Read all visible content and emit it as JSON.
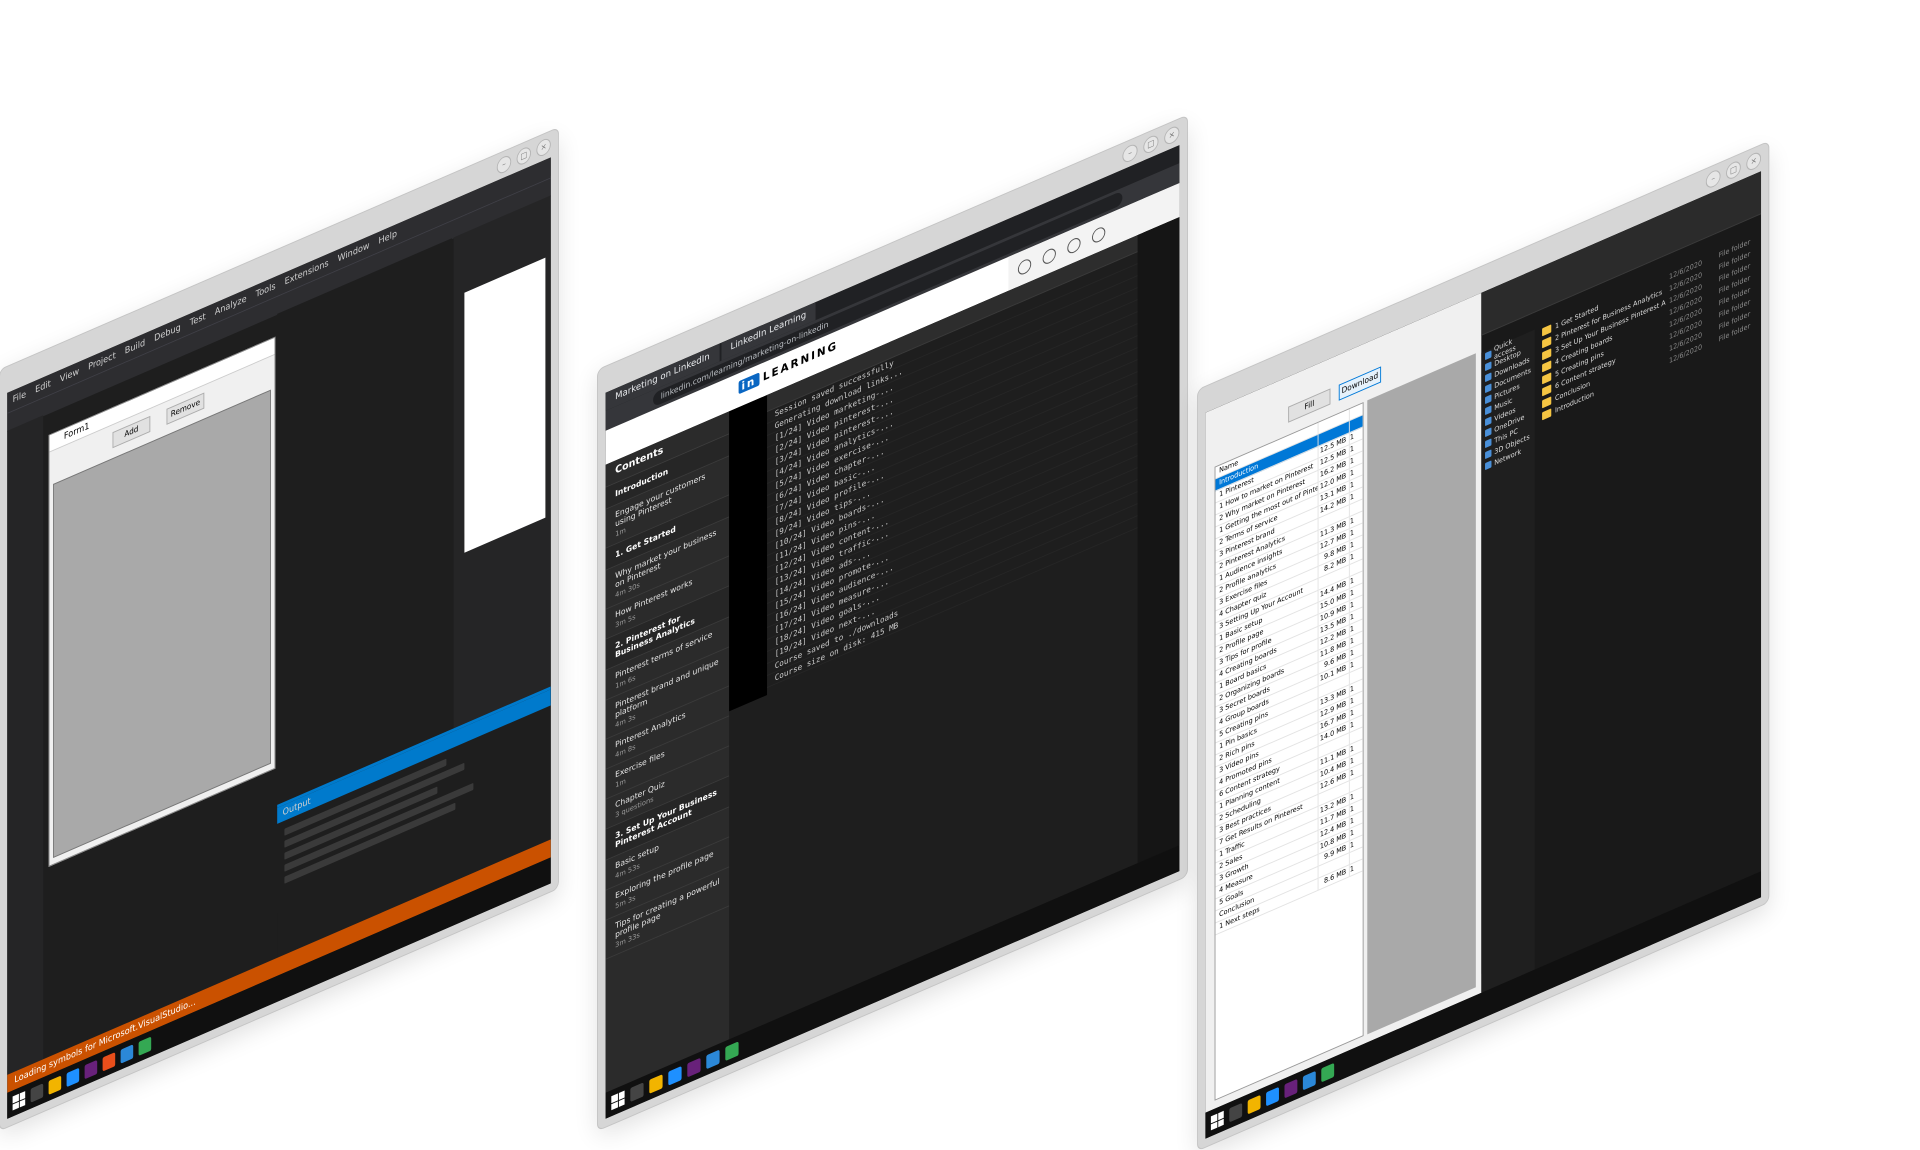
{
  "screens": {
    "vs": {
      "menu": [
        "File",
        "Edit",
        "View",
        "Project",
        "Build",
        "Debug",
        "Test",
        "Analyze",
        "Tools",
        "Extensions",
        "Window",
        "Help"
      ],
      "form_title": "Form1",
      "form_buttons": [
        "Add",
        "Remove"
      ],
      "output_tab": "Output",
      "status_text": "Loading symbols for Microsoft.VisualStudio..."
    },
    "browser": {
      "tabs": [
        "Marketing on LinkedIn",
        "LinkedIn Learning"
      ],
      "url": "linkedin.com/learning/marketing-on-linkedin",
      "logo_in": "in",
      "logo_text": "LEARNING",
      "sidebar_title": "Contents",
      "course_items": [
        {
          "type": "section",
          "title": "Introduction"
        },
        {
          "type": "item",
          "title": "Engage your customers using Pinterest",
          "dur": "1m"
        },
        {
          "type": "section",
          "title": "1. Get Started"
        },
        {
          "type": "item",
          "title": "Why market your business on Pinterest",
          "dur": "4m 30s"
        },
        {
          "type": "item",
          "title": "How Pinterest works",
          "dur": "3m 5s"
        },
        {
          "type": "section",
          "title": "2. Pinterest for Business Analytics"
        },
        {
          "type": "item",
          "title": "Pinterest terms of service",
          "dur": "1m 6s"
        },
        {
          "type": "item",
          "title": "Pinterest brand and unique platform",
          "dur": "4m 3s"
        },
        {
          "type": "item",
          "title": "Pinterest Analytics",
          "dur": "4m 8s"
        },
        {
          "type": "item",
          "title": "Exercise files",
          "dur": "1m"
        },
        {
          "type": "item",
          "title": "Chapter Quiz",
          "dur": "3 questions"
        },
        {
          "type": "section",
          "title": "3. Set Up Your Business Pinterest Account"
        },
        {
          "type": "item",
          "title": "Basic setup",
          "dur": "4m 53s"
        },
        {
          "type": "item",
          "title": "Exploring the profile page",
          "dur": "5m 3s"
        },
        {
          "type": "item",
          "title": "Tips for creating a powerful profile page",
          "dur": "3m 33s"
        }
      ],
      "terminal_lines": [
        "Session saved successfully",
        "Generating download links...",
        "[1/24] Video marketing-...",
        "[2/24] Video pinterest-...",
        "[3/24] Video pinterest-...",
        "[4/24] Video analytics-...",
        "[5/24] Video exercise-...",
        "[6/24] Video chapter-...",
        "[7/24] Video basic-...",
        "[8/24] Video profile-...",
        "[9/24] Video tips-...",
        "[10/24] Video boards-...",
        "[11/24] Video pins-...",
        "[12/24] Video content-...",
        "[13/24] Video traffic-...",
        "[14/24] Video ads-...",
        "[15/24] Video promote-...",
        "[16/24] Video audience-...",
        "[17/24] Video measure-...",
        "[18/24] Video goals-...",
        "[19/24] Video next-...",
        "Course saved to ./downloads",
        "Course size on disk: 415 MB"
      ]
    },
    "explorer": {
      "buttons": [
        "Fill",
        "Download"
      ],
      "table_rows": [
        {
          "name": "Name",
          "size": "",
          "n": ""
        },
        {
          "name": "Introduction",
          "size": "",
          "n": ""
        },
        {
          "name": "1 Pinterest",
          "size": "12.5 MB",
          "n": "1"
        },
        {
          "name": "1 How to market on Pinterest",
          "size": "12.5 MB",
          "n": "1"
        },
        {
          "name": "2 Why market on Pinterest",
          "size": "16.2 MB",
          "n": "1"
        },
        {
          "name": "1 Getting the most out of Pinterest",
          "size": "12.0 MB",
          "n": "1"
        },
        {
          "name": "2 Terms of service",
          "size": "13.1 MB",
          "n": "1"
        },
        {
          "name": "3 Pinterest brand",
          "size": "14.2 MB",
          "n": "1"
        },
        {
          "name": "2 Pinterest Analytics",
          "size": "",
          "n": ""
        },
        {
          "name": "1 Audience insights",
          "size": "11.3 MB",
          "n": "1"
        },
        {
          "name": "2 Profile analytics",
          "size": "12.7 MB",
          "n": "1"
        },
        {
          "name": "3 Exercise files",
          "size": "9.8 MB",
          "n": "1"
        },
        {
          "name": "4 Chapter quiz",
          "size": "8.2 MB",
          "n": "1"
        },
        {
          "name": "3 Setting Up Your Account",
          "size": "",
          "n": ""
        },
        {
          "name": "1 Basic setup",
          "size": "14.4 MB",
          "n": "1"
        },
        {
          "name": "2 Profile page",
          "size": "15.0 MB",
          "n": "1"
        },
        {
          "name": "3 Tips for profile",
          "size": "10.9 MB",
          "n": "1"
        },
        {
          "name": "4 Creating boards",
          "size": "13.5 MB",
          "n": "1"
        },
        {
          "name": "1 Board basics",
          "size": "12.2 MB",
          "n": "1"
        },
        {
          "name": "2 Organizing boards",
          "size": "11.8 MB",
          "n": "1"
        },
        {
          "name": "3 Secret boards",
          "size": "9.6 MB",
          "n": "1"
        },
        {
          "name": "4 Group boards",
          "size": "10.1 MB",
          "n": "1"
        },
        {
          "name": "5 Creating pins",
          "size": "",
          "n": ""
        },
        {
          "name": "1 Pin basics",
          "size": "13.3 MB",
          "n": "1"
        },
        {
          "name": "2 Rich pins",
          "size": "12.9 MB",
          "n": "1"
        },
        {
          "name": "3 Video pins",
          "size": "16.7 MB",
          "n": "1"
        },
        {
          "name": "4 Promoted pins",
          "size": "14.0 MB",
          "n": "1"
        },
        {
          "name": "6 Content strategy",
          "size": "",
          "n": ""
        },
        {
          "name": "1 Planning content",
          "size": "11.1 MB",
          "n": "1"
        },
        {
          "name": "2 Scheduling",
          "size": "10.4 MB",
          "n": "1"
        },
        {
          "name": "3 Best practices",
          "size": "12.6 MB",
          "n": "1"
        },
        {
          "name": "7 Get Results on Pinterest",
          "size": "",
          "n": ""
        },
        {
          "name": "1 Traffic",
          "size": "13.2 MB",
          "n": "1"
        },
        {
          "name": "2 Sales",
          "size": "11.7 MB",
          "n": "1"
        },
        {
          "name": "3 Growth",
          "size": "12.4 MB",
          "n": "1"
        },
        {
          "name": "4 Measure",
          "size": "10.8 MB",
          "n": "1"
        },
        {
          "name": "5 Goals",
          "size": "9.9 MB",
          "n": "1"
        },
        {
          "name": "Conclusion",
          "size": "",
          "n": ""
        },
        {
          "name": "1 Next steps",
          "size": "8.6 MB",
          "n": "1"
        }
      ],
      "nav_items": [
        "Quick access",
        "Desktop",
        "Downloads",
        "Documents",
        "Pictures",
        "Music",
        "Videos",
        "OneDrive",
        "This PC",
        "3D Objects",
        "Network"
      ],
      "folders": [
        "1 Get Started",
        "2 Pinterest for Business Analytics",
        "3 Set Up Your Business Pinterest Account",
        "4 Creating boards",
        "5 Creating pins",
        "6 Content strategy",
        "Conclusion",
        "Introduction"
      ],
      "folder_dates": [
        "12/6/2020",
        "12/6/2020",
        "12/6/2020",
        "12/6/2020",
        "12/6/2020",
        "12/6/2020",
        "12/6/2020",
        "12/6/2020"
      ],
      "folder_type": "File folder"
    }
  },
  "colors": {
    "vs_status": "#ca5100",
    "vs_accent": "#007acc",
    "selection": "#0078d7",
    "folder": "#f5c542"
  }
}
